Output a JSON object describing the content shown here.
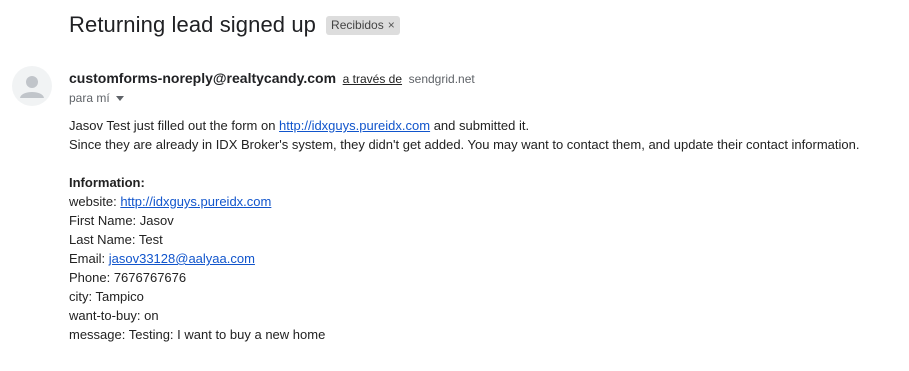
{
  "email": {
    "subject": "Returning lead signed up",
    "label": "Recibidos",
    "label_close": "×",
    "sender": "customforms-noreply@realtycandy.com",
    "via_text": "a través de",
    "via_domain": "sendgrid.net",
    "to_text": "para mí",
    "body": {
      "line1_prefix": "Jasov Test just filled out the form on",
      "line1_link": "http://idxguys.pureidx.com",
      "line1_suffix": "and submitted it.",
      "line2": "Since they are already in IDX Broker's system, they didn't get added. You may want to contact them, and update their contact information.",
      "info_heading": "Information:",
      "website_label": "website:",
      "website_link": "http://idxguys.pureidx.com",
      "first_name": "First Name: Jasov",
      "last_name": "Last Name: Test",
      "email_label": "Email:",
      "email_link": "jasov33128@aalyaa.com",
      "phone": "Phone: 7676767676",
      "city": "city: Tampico",
      "want_to_buy": "want-to-buy: on",
      "message": "message: Testing: I want to buy a new home"
    }
  },
  "icons": {
    "avatar": "person-avatar-icon",
    "label_close": "close-icon",
    "to_dropdown": "chevron-down-icon"
  },
  "colors": {
    "link": "#1155cc",
    "chip_bg": "#dddddd",
    "avatar_bg": "#f1f3f4"
  }
}
